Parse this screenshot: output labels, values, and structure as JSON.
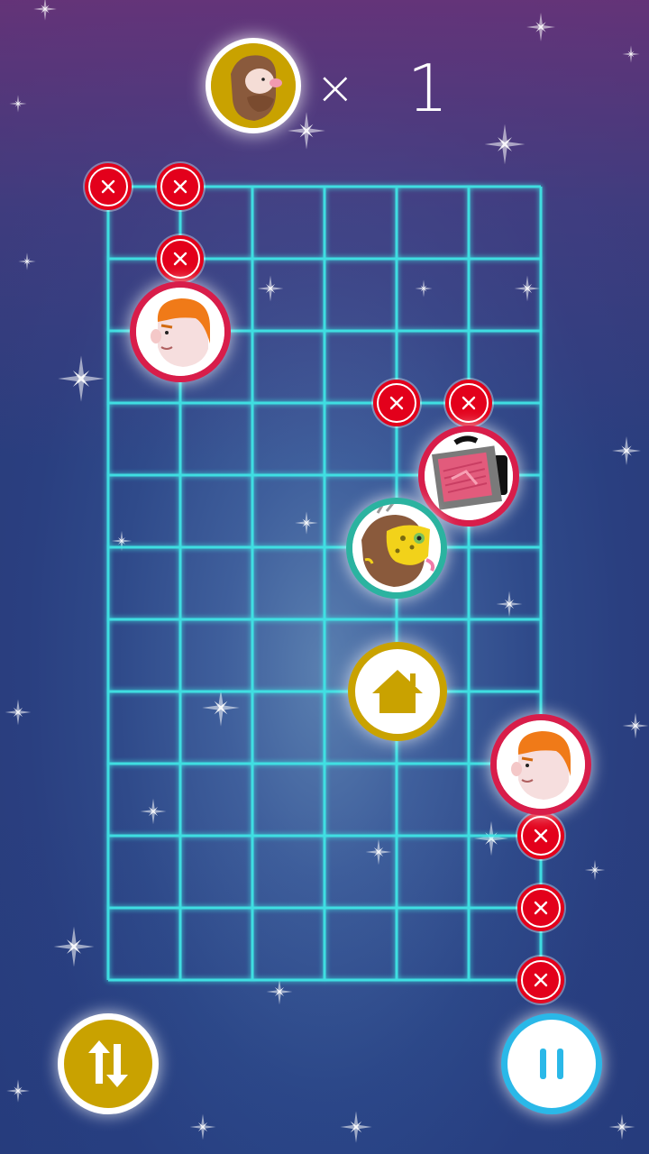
{
  "hud": {
    "avatar_icon": "bearded-man-avatar",
    "multiplier_sign": "×",
    "count": "1"
  },
  "board": {
    "columns": 6,
    "rows": 11,
    "grid_color": "#3fe6e6"
  },
  "pieces": {
    "red_ginger_man": "ginger-man-face",
    "green_bearded_man": "bearded-man-with-mask",
    "red_screen": "glitch-monitor",
    "home_target": "home-icon",
    "markers": "red-x-marker"
  },
  "controls": {
    "swap_icon": "swap-arrows-icon",
    "pause_icon": "pause-icon"
  },
  "colors": {
    "gold": "#c9a200",
    "crimson": "#d81d4a",
    "teal": "#2bb3a0",
    "marker_red": "#e3001b",
    "pause_blue": "#2ab8e8"
  }
}
